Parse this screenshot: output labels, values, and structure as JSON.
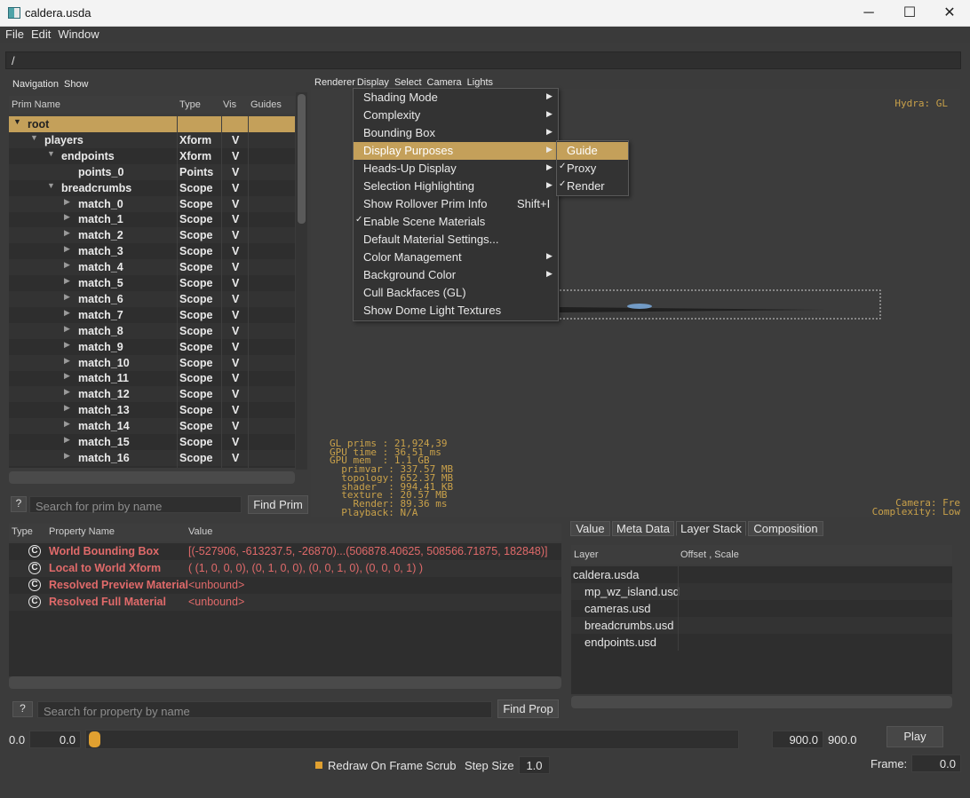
{
  "window": {
    "title": "caldera.usda",
    "minimize": "─",
    "maximize": "☐",
    "close": "✕"
  },
  "menubar": [
    "File",
    "Edit",
    "Window"
  ],
  "path": "/",
  "left_menu": [
    "Navigation",
    "Show"
  ],
  "tree": {
    "headers": [
      "Prim Name",
      "Type",
      "Vis",
      "Guides"
    ],
    "rows": [
      {
        "name": "root",
        "type": "",
        "vis": "",
        "depth": 0,
        "expander": "open",
        "selected": true
      },
      {
        "name": "players",
        "type": "Xform",
        "vis": "V",
        "depth": 1,
        "expander": "open"
      },
      {
        "name": "endpoints",
        "type": "Xform",
        "vis": "V",
        "depth": 2,
        "expander": "open"
      },
      {
        "name": "points_0",
        "type": "Points",
        "vis": "V",
        "depth": 3,
        "expander": "none"
      },
      {
        "name": "breadcrumbs",
        "type": "Scope",
        "vis": "V",
        "depth": 2,
        "expander": "open"
      },
      {
        "name": "match_0",
        "type": "Scope",
        "vis": "V",
        "depth": 3,
        "expander": "closed"
      },
      {
        "name": "match_1",
        "type": "Scope",
        "vis": "V",
        "depth": 3,
        "expander": "closed"
      },
      {
        "name": "match_2",
        "type": "Scope",
        "vis": "V",
        "depth": 3,
        "expander": "closed"
      },
      {
        "name": "match_3",
        "type": "Scope",
        "vis": "V",
        "depth": 3,
        "expander": "closed"
      },
      {
        "name": "match_4",
        "type": "Scope",
        "vis": "V",
        "depth": 3,
        "expander": "closed"
      },
      {
        "name": "match_5",
        "type": "Scope",
        "vis": "V",
        "depth": 3,
        "expander": "closed"
      },
      {
        "name": "match_6",
        "type": "Scope",
        "vis": "V",
        "depth": 3,
        "expander": "closed"
      },
      {
        "name": "match_7",
        "type": "Scope",
        "vis": "V",
        "depth": 3,
        "expander": "closed"
      },
      {
        "name": "match_8",
        "type": "Scope",
        "vis": "V",
        "depth": 3,
        "expander": "closed"
      },
      {
        "name": "match_9",
        "type": "Scope",
        "vis": "V",
        "depth": 3,
        "expander": "closed"
      },
      {
        "name": "match_10",
        "type": "Scope",
        "vis": "V",
        "depth": 3,
        "expander": "closed"
      },
      {
        "name": "match_11",
        "type": "Scope",
        "vis": "V",
        "depth": 3,
        "expander": "closed"
      },
      {
        "name": "match_12",
        "type": "Scope",
        "vis": "V",
        "depth": 3,
        "expander": "closed"
      },
      {
        "name": "match_13",
        "type": "Scope",
        "vis": "V",
        "depth": 3,
        "expander": "closed"
      },
      {
        "name": "match_14",
        "type": "Scope",
        "vis": "V",
        "depth": 3,
        "expander": "closed"
      },
      {
        "name": "match_15",
        "type": "Scope",
        "vis": "V",
        "depth": 3,
        "expander": "closed"
      },
      {
        "name": "match_16",
        "type": "Scope",
        "vis": "V",
        "depth": 3,
        "expander": "closed"
      }
    ]
  },
  "prim_search": {
    "help": "?",
    "placeholder": "Search for prim by name",
    "button": "Find Prim"
  },
  "viewport_menu": [
    "Renderer",
    "Display",
    "Select",
    "Camera",
    "Lights"
  ],
  "display_menu": [
    {
      "label": "Shading Mode",
      "submenu": true
    },
    {
      "label": "Complexity",
      "submenu": true
    },
    {
      "label": "Bounding Box",
      "submenu": true
    },
    {
      "label": "Display Purposes",
      "submenu": true,
      "highlighted": true
    },
    {
      "label": "Heads-Up Display",
      "submenu": true
    },
    {
      "label": "Selection Highlighting",
      "submenu": true
    },
    {
      "label": "Show Rollover Prim Info",
      "shortcut": "Shift+I"
    },
    {
      "label": "Enable Scene Materials",
      "checked": true
    },
    {
      "label": "Default Material Settings..."
    },
    {
      "label": "Color Management",
      "submenu": true
    },
    {
      "label": "Background Color",
      "submenu": true
    },
    {
      "label": "Cull Backfaces (GL)"
    },
    {
      "label": "Show Dome Light Textures"
    }
  ],
  "purposes_menu": [
    {
      "label": "Guide",
      "highlighted": true,
      "checked": false
    },
    {
      "label": "Proxy",
      "checked": true
    },
    {
      "label": "Render",
      "checked": true
    }
  ],
  "hud": {
    "renderer": "Hydra: GL",
    "stats": "GL prims : 21,924,39\nGPU time : 36.51 ms\nGPU mem  : 1.1 GB\n  primvar : 337.57 MB\n  topology: 652.37 MB\n  shader  : 994.41 KB\n  texture : 20.57 MB\n    Render: 89.36 ms\n  Playback: N/A",
    "camera": "Camera: Fre",
    "complexity": "Complexity: Low"
  },
  "properties": {
    "headers": [
      "Type",
      "Property Name",
      "Value"
    ],
    "rows": [
      {
        "icon": "C",
        "name": "World Bounding Box",
        "value": "[(-527906, -613237.5, -26870)...(506878.40625, 508566.71875, 182848)]"
      },
      {
        "icon": "C",
        "name": "Local to World Xform",
        "value": "( (1, 0, 0, 0), (0, 1, 0, 0), (0, 0, 1, 0), (0, 0, 0, 1) )"
      },
      {
        "icon": "C",
        "name": "Resolved Preview Material",
        "value": "<unbound>"
      },
      {
        "icon": "C",
        "name": "Resolved Full Material",
        "value": "<unbound>"
      }
    ]
  },
  "prop_search": {
    "help": "?",
    "placeholder": "Search for property by name",
    "button": "Find Prop"
  },
  "tabs": [
    "Value",
    "Meta Data",
    "Layer Stack",
    "Composition"
  ],
  "layers": {
    "headers": [
      "Layer",
      "Offset , Scale"
    ],
    "rows": [
      "caldera.usda",
      "mp_wz_island.usd",
      "cameras.usd",
      "breadcrumbs.usd",
      "endpoints.usd"
    ]
  },
  "timeline": {
    "start_label": "0.0",
    "start_value": "0.0",
    "end_value": "900.0",
    "end_label": "900.0",
    "play": "Play",
    "redraw_label": "Redraw On Frame Scrub",
    "step_label": "Step Size",
    "step_value": "1.0",
    "frame_label": "Frame:",
    "frame_value": "0.0",
    "accent": "#e0a030"
  }
}
